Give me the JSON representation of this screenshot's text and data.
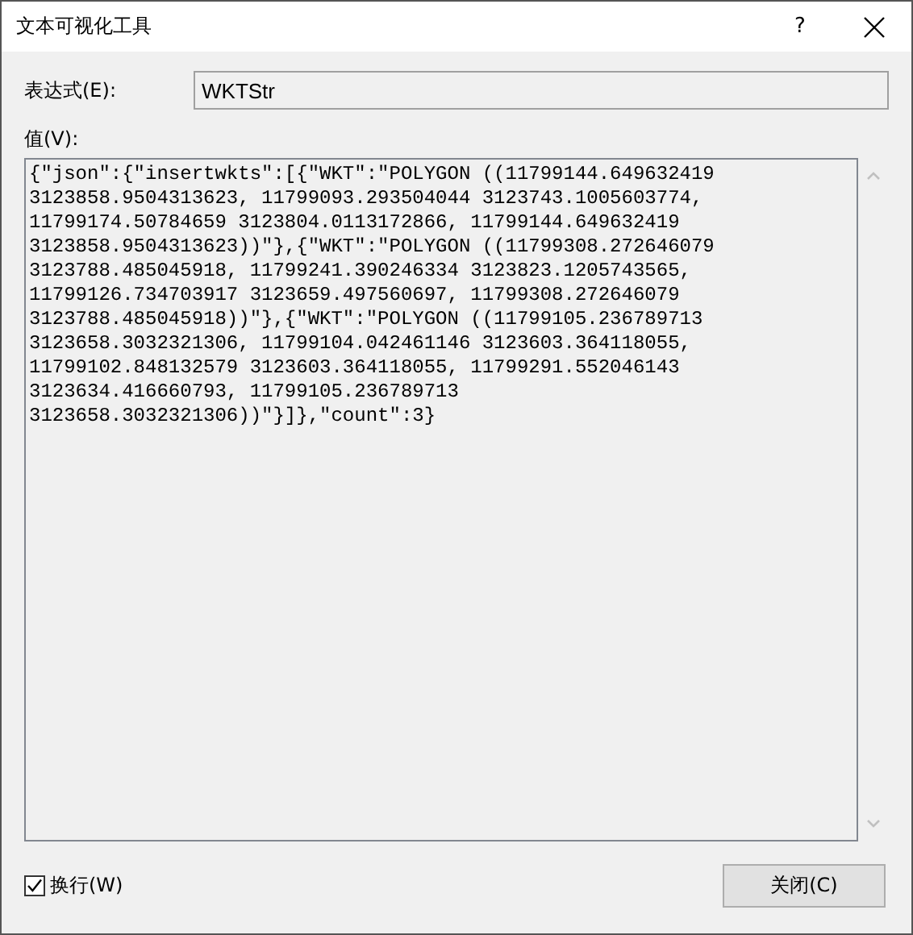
{
  "window": {
    "title": "文本可视化工具",
    "help": "?"
  },
  "expression": {
    "label": "表达式(E):",
    "value": "WKTStr"
  },
  "value": {
    "label": "值(V):",
    "lines": [
      "{\"json\":{\"insertwkts\":[{\"WKT\":\"POLYGON ((11799144.649632419",
      "3123858.9504313623, 11799093.293504044 3123743.1005603774,",
      "11799174.50784659 3123804.0113172866, 11799144.649632419",
      "3123858.9504313623))\"},{\"WKT\":\"POLYGON ((11799308.272646079",
      "3123788.485045918, 11799241.390246334 3123823.1205743565,",
      "11799126.734703917 3123659.497560697, 11799308.272646079",
      "3123788.485045918))\"},{\"WKT\":\"POLYGON ((11799105.236789713",
      "3123658.3032321306, 11799104.042461146 3123603.364118055,",
      "11799102.848132579 3123603.364118055, 11799291.552046143",
      "3123634.416660793, 11799105.236789713",
      "3123658.3032321306))\"}]},\"count\":3}"
    ]
  },
  "wrap": {
    "label": "换行(W)",
    "checked": true
  },
  "close_button": "关闭(C)"
}
